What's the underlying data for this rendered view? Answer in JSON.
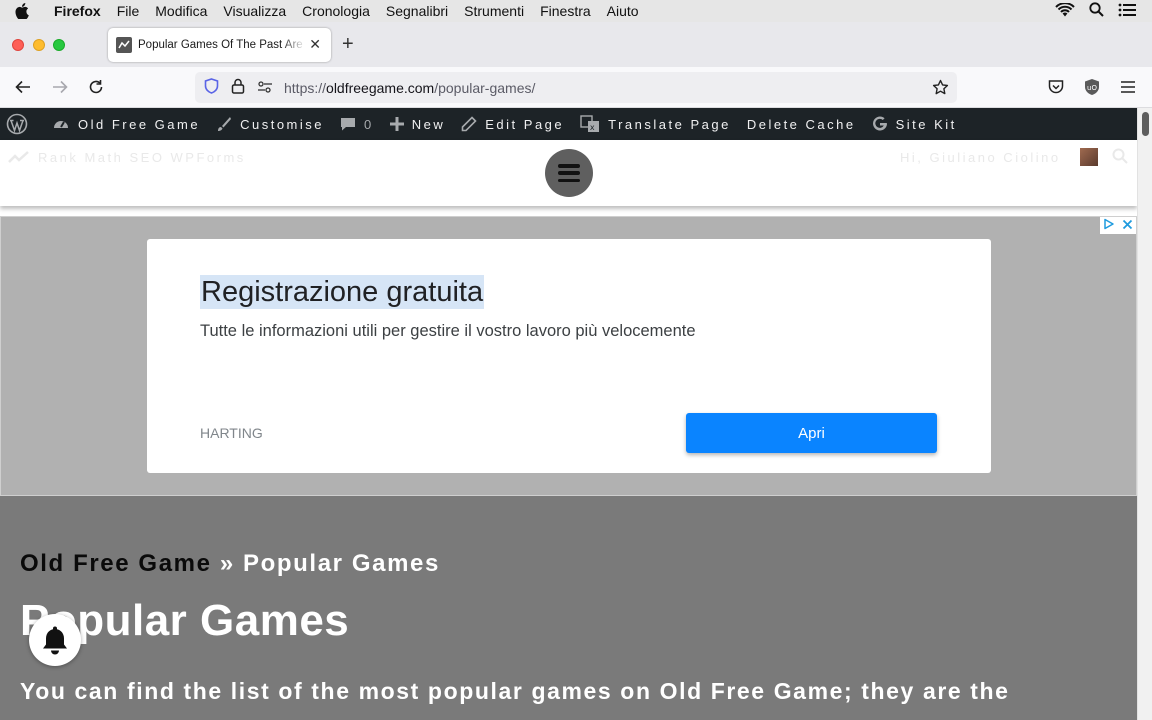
{
  "menubar": {
    "app_name": "Firefox",
    "items": [
      "File",
      "Modifica",
      "Visualizza",
      "Cronologia",
      "Segnalibri",
      "Strumenti",
      "Finestra",
      "Aiuto"
    ]
  },
  "browser": {
    "tab_title": "Popular Games Of The Past Are",
    "tab_close": "✕",
    "new_tab": "+",
    "url_protocol": "https://",
    "url_host": "oldfreegame.com",
    "url_path": "/popular-games/"
  },
  "adminbar": {
    "site_name": "Old Free Game",
    "customise": "Customise",
    "comments_count": "0",
    "new": "New",
    "edit_page": "Edit Page",
    "translate_page": "Translate Page",
    "delete_cache": "Delete Cache",
    "site_kit": "Site Kit"
  },
  "header": {
    "secondary_left": "Rank Math SEO   WPForms",
    "greeting": "Hi, Giuliano Ciolino"
  },
  "ad": {
    "title": "Registrazione gratuita",
    "description": "Tutte le informazioni utili per gestire il vostro lavoro più velocemente",
    "brand": "HARTING",
    "cta": "Apri"
  },
  "content": {
    "breadcrumb_home": "Old Free Game",
    "breadcrumb_sep": "»",
    "breadcrumb_current": "Popular Games",
    "title": "Popular Games",
    "intro": "You can find the list of the most popular games on Old Free Game; they are the"
  },
  "colors": {
    "adminbar_bg": "#1d2327",
    "cta_blue": "#0a84ff",
    "overlay_gray": "#7a7a7a"
  }
}
